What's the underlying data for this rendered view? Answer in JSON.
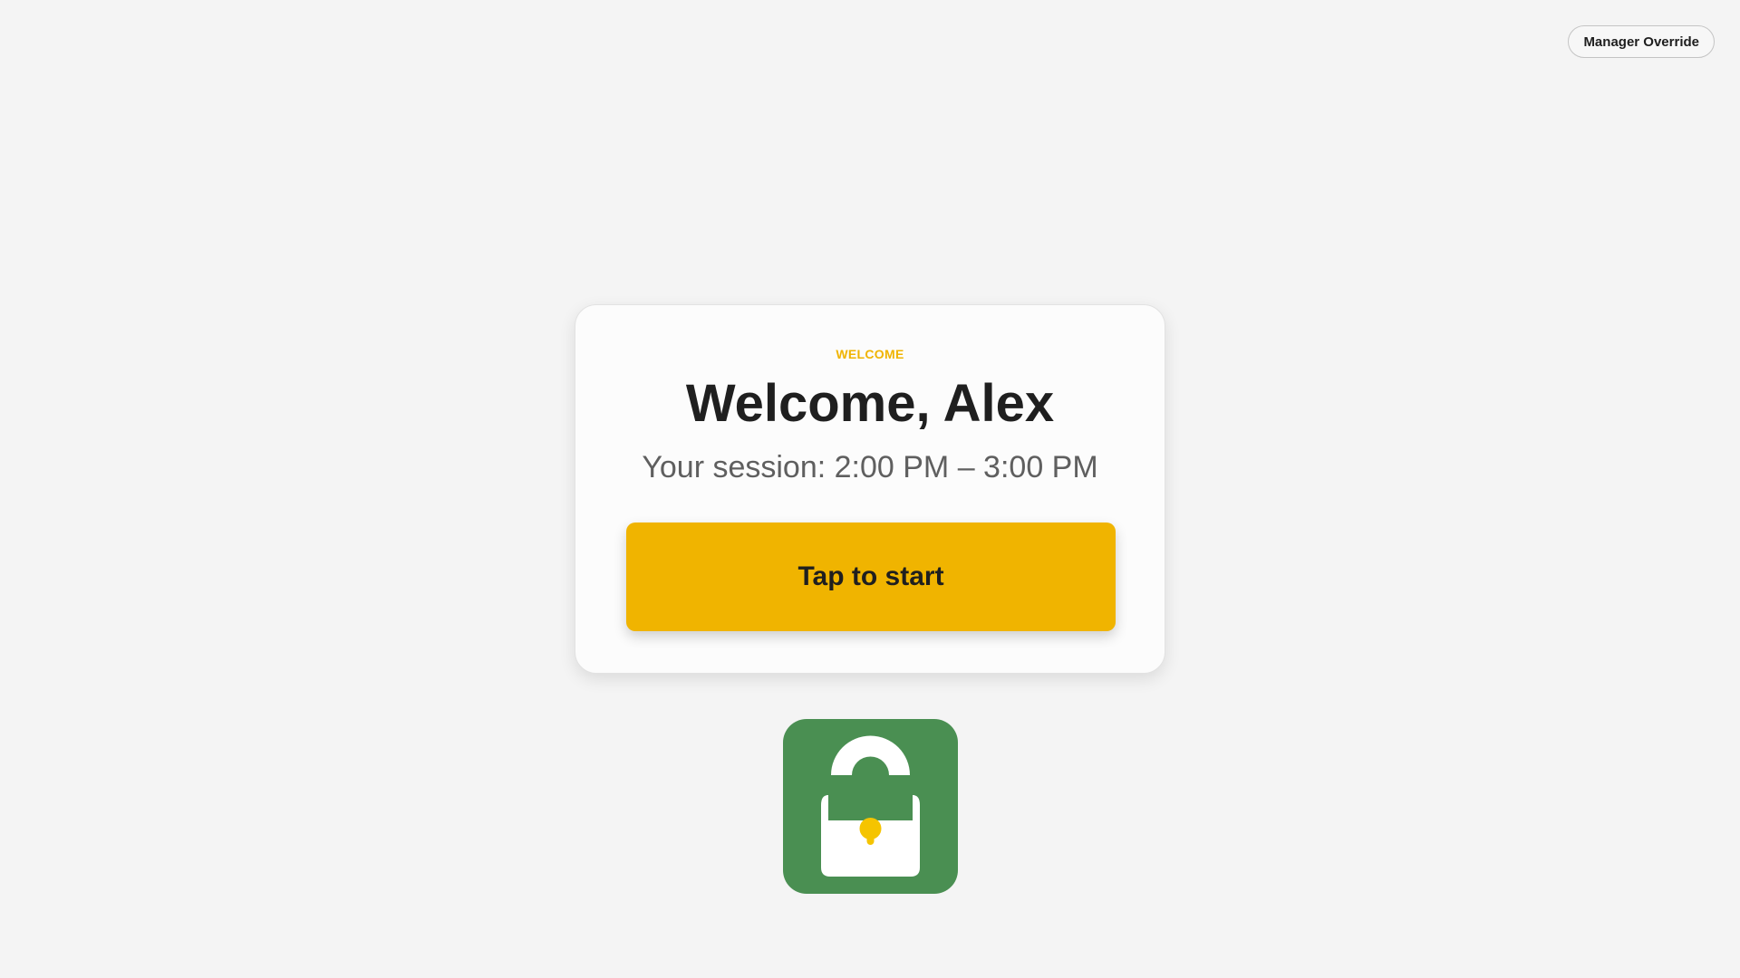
{
  "header": {
    "manager_override_label": "Manager Override"
  },
  "welcome_card": {
    "eyebrow": "WELCOME",
    "headline": "Welcome, Alex",
    "session_text": "Your session: 2:00 PM – 3:00 PM",
    "start_button_label": "Tap to start"
  },
  "logo": {
    "icon": "open-lock-icon",
    "background_color": "#4a8f52",
    "keyhole_color": "#f5c400"
  },
  "colors": {
    "accent": "#f0b400",
    "page_background": "#f4f4f4",
    "brand_green": "#4a8f52"
  }
}
